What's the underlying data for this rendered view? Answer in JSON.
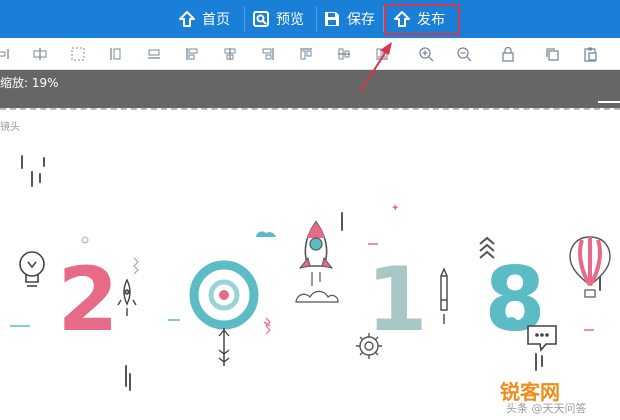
{
  "colors": {
    "nav_bg": "#1a7fd6",
    "highlight": "#d8364a",
    "zoom_bg": "#666666",
    "pink": "#e76b86",
    "teal": "#5bbcc6",
    "gray_teal": "#a9c7c6"
  },
  "nav": {
    "home_label": "首页",
    "home_icon": "up-arrow-icon",
    "preview_label": "预览",
    "preview_icon": "preview-icon",
    "save_label": "保存",
    "save_icon": "floppy-disk-icon",
    "publish_label": "发布",
    "publish_icon": "up-arrow-icon"
  },
  "toolbar": {
    "tools": [
      "distribute-horizontal-icon",
      "distribute-center-icon",
      "dashed-box-icon",
      "align-vertical-icon",
      "align-horizontal-icon",
      "align-left-icon",
      "align-center-icon",
      "align-right-icon",
      "align-top-icon",
      "align-middle-icon",
      "align-bottom-icon",
      "zoom-in-icon",
      "zoom-out-icon",
      "lock-icon",
      "copy-icon",
      "paste-icon"
    ]
  },
  "zoom": {
    "text": "缩放: 19%"
  },
  "canvas": {
    "label": "镜头",
    "digits": [
      "2",
      "0",
      "1",
      "8"
    ]
  },
  "watermark": {
    "text": "锐客网",
    "sub": "头条 @天天问答"
  }
}
